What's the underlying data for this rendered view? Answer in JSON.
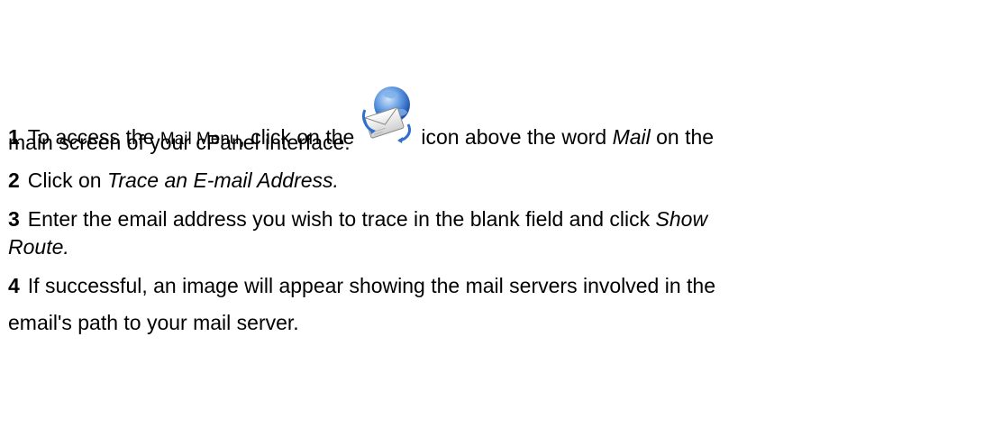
{
  "steps": [
    {
      "number": "1",
      "line1_before": "To access the",
      "line1_small": "Mail Menu",
      "line1_mid": ", click on the",
      "line1_after_icon": "icon above the word",
      "line1_italic": "Mail",
      "line1_end": "on the",
      "line2": "main screen of your cPanel interface.",
      "icon": "mail-globe-icon"
    },
    {
      "number": "2",
      "text_before": "Click on",
      "italic": "Trace an E-mail Address."
    },
    {
      "number": "3",
      "line1_before": "Enter the email address you wish to trace in the blank field and click",
      "line1_italic": "Show",
      "line2_italic": "Route."
    },
    {
      "number": "4",
      "line1": "If successful, an image will appear showing the mail servers involved in the",
      "line2": "email's path to your mail server."
    }
  ],
  "colors": {
    "text": "#000000",
    "globe_blue": "#2f6fd0",
    "globe_light": "#9cc3f2",
    "envelope": "#f4f4f4"
  }
}
